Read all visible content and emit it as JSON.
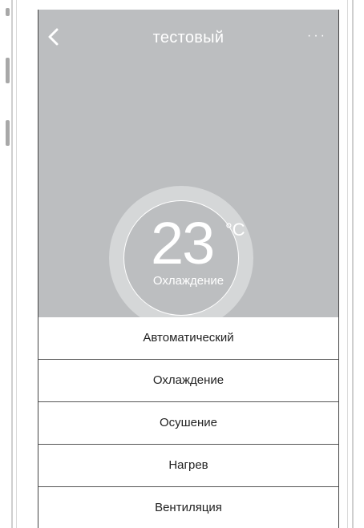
{
  "header": {
    "title": "тестовый",
    "more_label": "···"
  },
  "dial": {
    "temperature": "23",
    "unit": "°C",
    "mode": "Охлаждение"
  },
  "modes": [
    "Автоматический",
    "Охлаждение",
    "Осушение",
    "Нагрев",
    "Вентиляция"
  ],
  "colors": {
    "header_bg": "#bcbec0",
    "dial_ring": "#d5d7d8",
    "text_light": "#ffffff",
    "text_dark": "#222222"
  },
  "icons": {
    "back": "chevron-left-icon",
    "more": "more-horizontal-icon"
  }
}
